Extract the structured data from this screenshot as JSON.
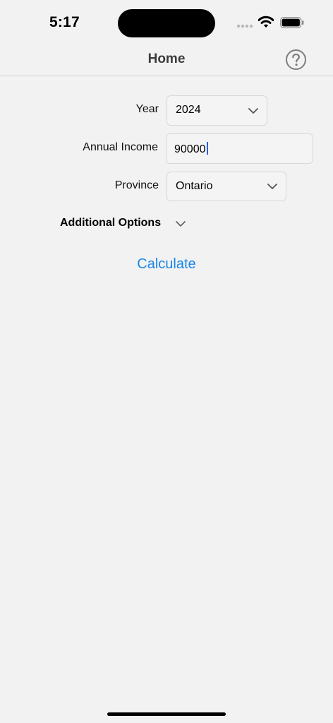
{
  "status_bar": {
    "time": "5:17",
    "icons": [
      "cellular-signal-icon",
      "wifi-icon",
      "battery-icon"
    ]
  },
  "nav": {
    "title": "Home",
    "help_icon": "question-circle-icon"
  },
  "form": {
    "year": {
      "label": "Year",
      "value": "2024",
      "icon": "chevron-down-icon"
    },
    "annual_income": {
      "label": "Annual Income",
      "value": "90000"
    },
    "province": {
      "label": "Province",
      "value": "Ontario",
      "icon": "chevron-down-icon"
    }
  },
  "additional_options": {
    "label": "Additional Options",
    "icon": "chevron-down-icon",
    "expanded": false
  },
  "actions": {
    "calculate_label": "Calculate"
  },
  "colors": {
    "background": "#f2f2f2",
    "accent": "#1a86e8",
    "caret": "#2563eb",
    "field_border": "#d8d8d8"
  }
}
